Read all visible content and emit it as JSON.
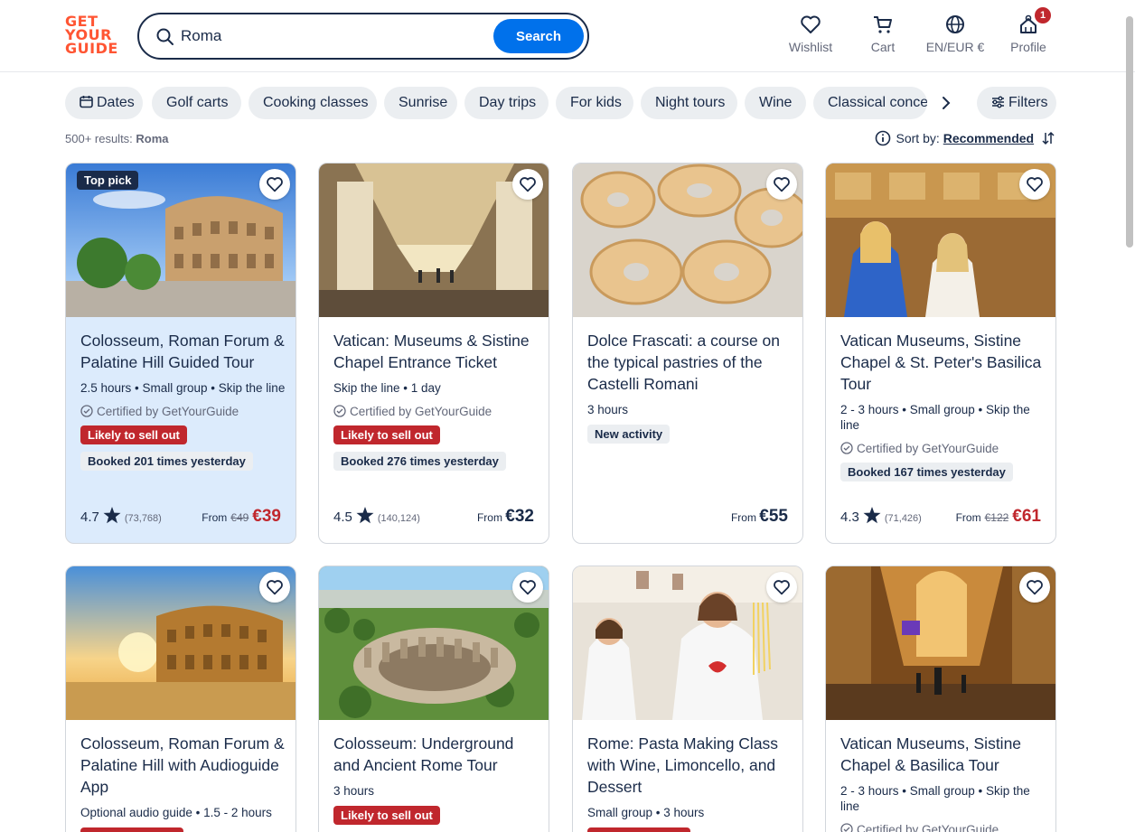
{
  "header": {
    "logo_lines": [
      "GET",
      "YOUR",
      "GUIDE"
    ],
    "search_value": "Roma",
    "search_button": "Search",
    "wishlist": "Wishlist",
    "cart": "Cart",
    "currency": "EN/EUR €",
    "profile": "Profile",
    "profile_badge": "1"
  },
  "filters": {
    "chips": [
      "Dates",
      "Golf carts",
      "Cooking classes",
      "Sunrise",
      "Day trips",
      "For kids",
      "Night tours",
      "Wine",
      "Classical concer"
    ],
    "filters_label": "Filters"
  },
  "results": {
    "count": "500+ results:",
    "query": "Roma",
    "sort_label": "Sort by:",
    "sort_value": "Recommended"
  },
  "cards": [
    {
      "title": "Colosseum, Roman Forum & Palatine Hill Guided Tour",
      "badge": "Top pick",
      "meta": "2.5 hours • Small group • Skip the line",
      "certified": "Certified by GetYourGuide",
      "tag_red": "Likely to sell out",
      "tag_gray": "Booked 201 times yesterday",
      "rating": "4.7",
      "reviews": "(73,768)",
      "from": "From",
      "old_price": "€49",
      "price": "€39"
    },
    {
      "title": "Vatican: Museums & Sistine Chapel Entrance Ticket",
      "meta": "Skip the line • 1 day",
      "certified": "Certified by GetYourGuide",
      "tag_red": "Likely to sell out",
      "tag_gray": "Booked 276 times yesterday",
      "rating": "4.5",
      "reviews": "(140,124)",
      "from": "From",
      "price": "€32"
    },
    {
      "title": "Dolce Frascati: a course on the typical pastries of the Castelli Romani",
      "meta": "3 hours",
      "tag_gray": "New activity",
      "from": "From",
      "price": "€55"
    },
    {
      "title": "Vatican Museums, Sistine Chapel & St. Peter's Basilica Tour",
      "meta": "2 - 3 hours • Small group • Skip the line",
      "certified": "Certified by GetYourGuide",
      "tag_gray": "Booked 167 times yesterday",
      "rating": "4.3",
      "reviews": "(71,426)",
      "from": "From",
      "old_price": "€122",
      "price": "€61"
    },
    {
      "title": "Colosseum, Roman Forum & Palatine Hill with Audioguide App",
      "meta": "Optional audio guide • 1.5 - 2 hours"
    },
    {
      "title": "Colosseum: Underground and Ancient Rome Tour",
      "meta": "3 hours",
      "tag_red": "Likely to sell out"
    },
    {
      "title": "Rome: Pasta Making Class with Wine, Limoncello, and Dessert",
      "meta": "Small group • 3 hours"
    },
    {
      "title": "Vatican Museums, Sistine Chapel & Basilica Tour",
      "meta": "2 - 3 hours • Small group • Skip the line",
      "certified": "Certified by GetYourGuide"
    }
  ]
}
